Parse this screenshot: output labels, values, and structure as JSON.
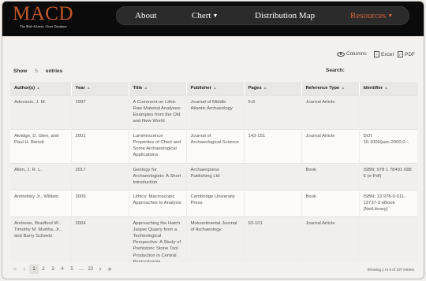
{
  "header": {
    "logo": "MACD",
    "logo_sub": "The Mid-Atlantic Chert Database",
    "nav": [
      {
        "label": "About"
      },
      {
        "label": "Chert"
      },
      {
        "label": "Distribution Map"
      },
      {
        "label": "Resources"
      }
    ]
  },
  "toolbar": {
    "columns_label": "Columns",
    "excel_label": "Excel",
    "pdf_label": "PDF",
    "show_prefix": "Show",
    "show_value": "5",
    "show_suffix": "entries",
    "search_label": "Search:"
  },
  "table": {
    "headers": [
      "Author(s)",
      "Year",
      "Title",
      "Publisher",
      "Pages",
      "Reference Type",
      "Identifier"
    ],
    "rows": [
      [
        "Adovasio, J. M.",
        "1997",
        "A Comment on Lithic Raw Material Analyses: Examples from the Old and New World",
        "Journal of Middle Atlantic Archaeology",
        "5-8",
        "Journal Article",
        ""
      ],
      [
        "Akridge, D. Glen, and Paul H. Benoit",
        "2001",
        "Luminescence Properties of Chert and Some Archaeological Applications",
        "Journal of Archaeological Science",
        "143-151",
        "Journal Article",
        "DOI: 10.1006/jasc.2000.0..."
      ],
      [
        "Allen, J. R. L.",
        "2017",
        "Geology for Archaeologists: A Short Introduction",
        "Archaeopress Publishing Ltd",
        "",
        "Book",
        "ISBN: 978 1 78491 688 6 (e-Pdf)"
      ],
      [
        "Andrefsky Jr., William",
        "2005",
        "Lithics: Macroscopic Approaches to Analysis",
        "Cambridge University Press",
        "",
        "Book",
        "ISBN: 13 978-0-511-13737-2 eBook (NetLibrary)"
      ],
      [
        "Andrews, Bradford W., Timothy M. Murtha, Jr., and Barry Scheetz",
        "2004",
        "Approaching the Hatch Jasper Quarry from a Technological Perspective: A Study of Prehistoric Stone Tool Production in Central Pennsylvania",
        "Midcontinental Journal of Archaeology",
        "63-101",
        "Journal Article",
        ""
      ]
    ]
  },
  "pagination": {
    "first": "«",
    "prev": "‹",
    "pages": [
      "1",
      "2",
      "3",
      "4",
      "5",
      "…",
      "22"
    ],
    "next": "›",
    "last": "»",
    "info": "Showing 1 to 5 of 107 entries"
  }
}
